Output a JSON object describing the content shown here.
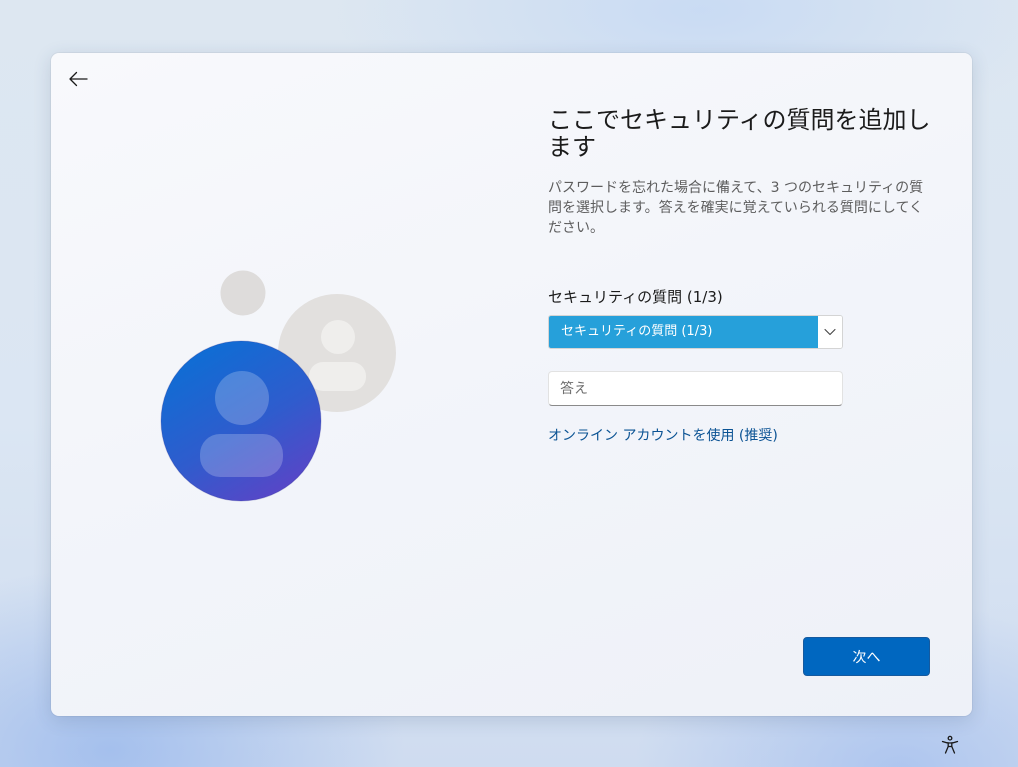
{
  "icons": {
    "back": "back-arrow-icon",
    "dropdown": "chevron-down-icon",
    "accessibility": "accessibility-icon",
    "avatar": "person-icon"
  },
  "colors": {
    "accent": "#0067c0",
    "selection_highlight": "#26a0da",
    "link": "#0b5394",
    "avatar_primary_start": "#0b6fd5",
    "avatar_primary_end": "#5e43c6",
    "avatar_secondary": "#e2e0de"
  },
  "page": {
    "title": "ここでセキュリティの質問を追加します",
    "description": "パスワードを忘れた場合に備えて、3 つのセキュリティの質問を選択します。答えを確実に覚えていられる質問にしてください。"
  },
  "form": {
    "question_label": "セキュリティの質問 (1/3)",
    "question_select": {
      "selected": "セキュリティの質問 (1/3)"
    },
    "answer_input": {
      "placeholder": "答え"
    },
    "online_account_link": "オンライン アカウントを使用 (推奨)"
  },
  "footer": {
    "next_label": "次へ"
  }
}
